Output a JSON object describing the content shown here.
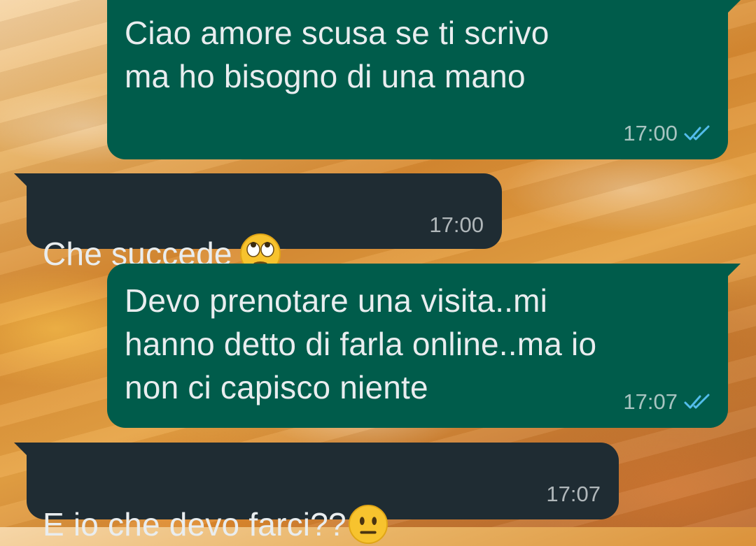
{
  "chat": {
    "messages": [
      {
        "direction": "outgoing",
        "text": "Ciao amore scusa se ti scrivo\nma ho bisogno di una mano",
        "time": "17:00",
        "status_icon": "double-check-read-icon",
        "status_color": "#53bdeb"
      },
      {
        "direction": "incoming",
        "text": "Che succede",
        "emoji": "face-with-rolling-eyes-icon",
        "time": "17:00"
      },
      {
        "direction": "outgoing",
        "text": "Devo prenotare una visita..mi\nhanno detto di farla online..ma io\nnon ci capisco niente",
        "time": "17:07",
        "status_icon": "double-check-read-icon",
        "status_color": "#53bdeb"
      },
      {
        "direction": "incoming",
        "text": "E io che devo farci??",
        "emoji": "neutral-face-icon",
        "time": "17:07"
      }
    ]
  },
  "theme": {
    "outgoing_bubble": "#005c4b",
    "incoming_bubble": "#1f2c33",
    "text_color": "#e9edef"
  }
}
